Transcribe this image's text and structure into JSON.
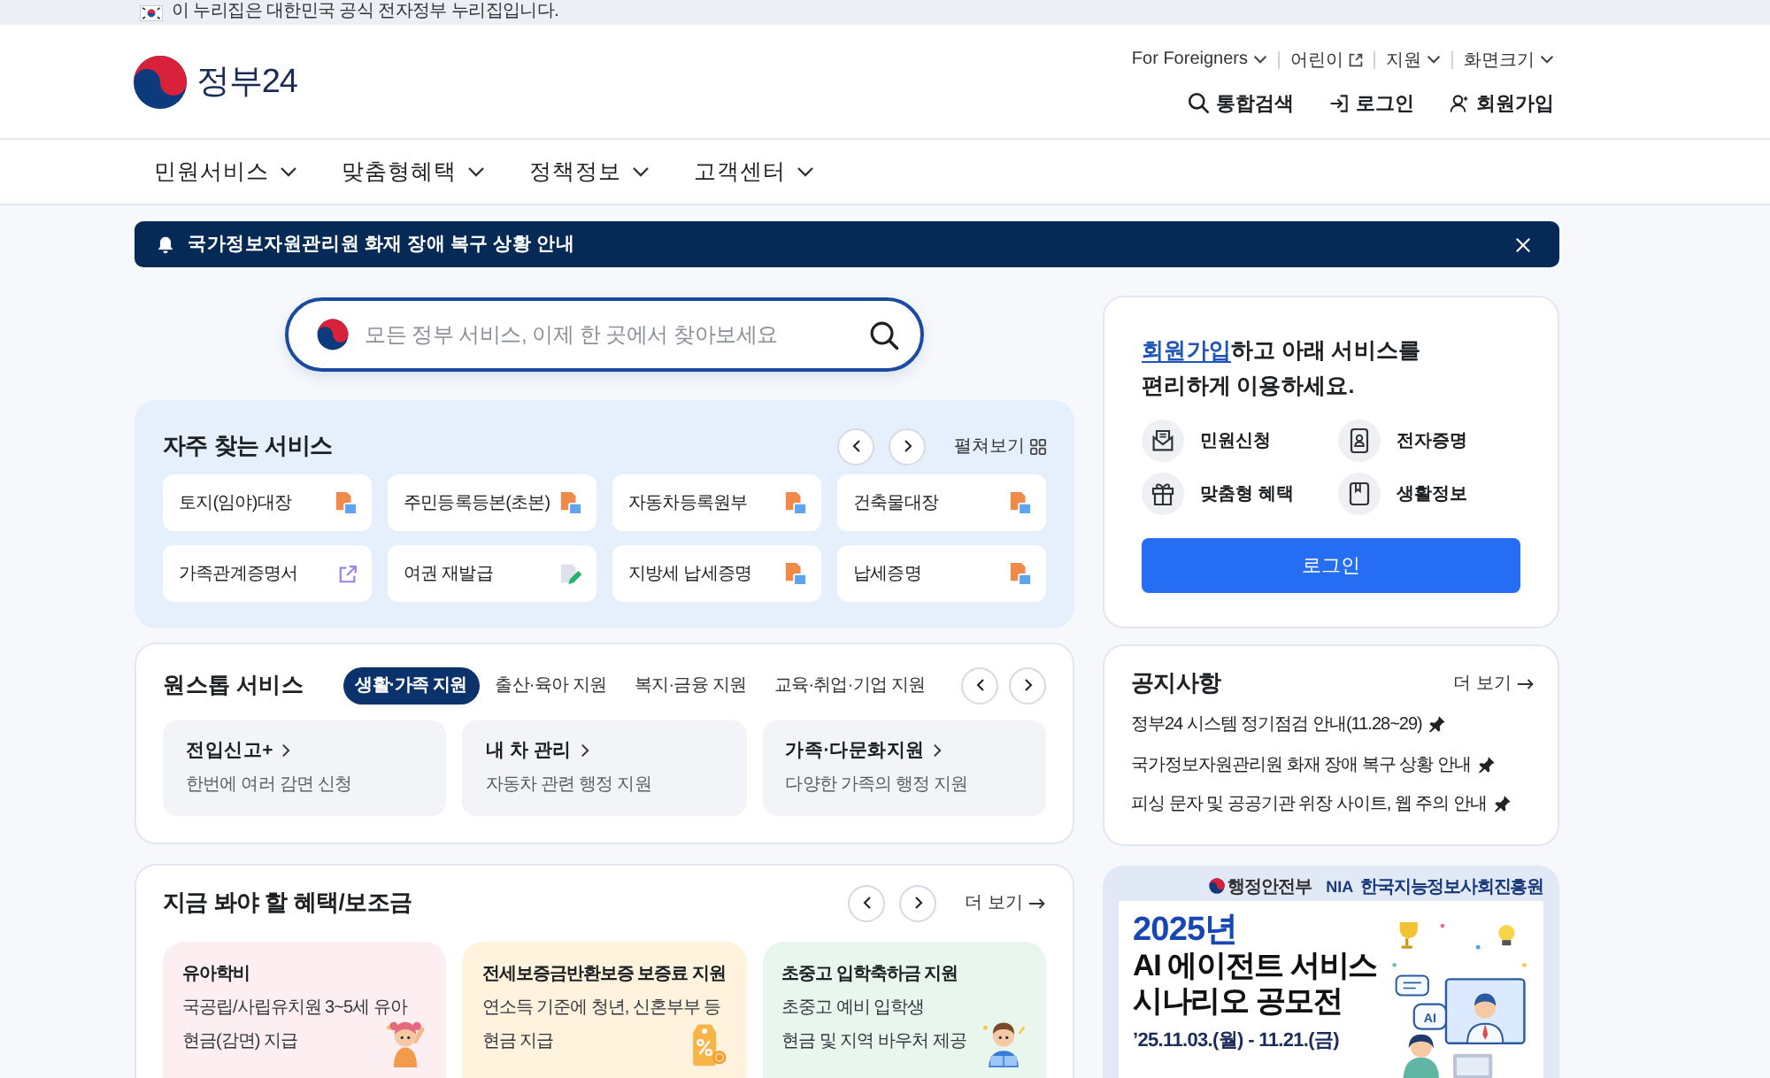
{
  "gov_notice": {
    "text": "이 누리집은 대한민국 공식 전자정부 누리집입니다."
  },
  "header": {
    "logo": "정부24",
    "utility_links": [
      {
        "label": "For Foreigners",
        "kind": "dropdown"
      },
      {
        "label": "어린이",
        "kind": "external"
      },
      {
        "label": "지원",
        "kind": "dropdown"
      },
      {
        "label": "화면크기",
        "kind": "dropdown"
      }
    ],
    "actions": [
      {
        "label": "통합검색",
        "kind": "search"
      },
      {
        "label": "로그인",
        "kind": "login"
      },
      {
        "label": "회원가입",
        "kind": "signup"
      }
    ]
  },
  "nav": {
    "items": [
      "민원서비스",
      "맞춤형혜택",
      "정책정보",
      "고객센터"
    ]
  },
  "alert": {
    "text": "국가정보자원관리원 화재 장애 복구 상황 안내"
  },
  "search": {
    "placeholder": "모든 정부 서비스, 이제 한 곳에서 찾아보세요"
  },
  "frequent_services": {
    "title": "자주 찾는 서비스",
    "expand": "펼쳐보기",
    "items": [
      {
        "label": "토지(임야)대장",
        "kind": "document"
      },
      {
        "label": "주민등록등본(초본)",
        "kind": "document"
      },
      {
        "label": "자동차등록원부",
        "kind": "document"
      },
      {
        "label": "건축물대장",
        "kind": "document"
      },
      {
        "label": "가족관계증명서",
        "kind": "external"
      },
      {
        "label": "여권 재발급",
        "kind": "edit"
      },
      {
        "label": "지방세 납세증명",
        "kind": "document"
      },
      {
        "label": "납세증명",
        "kind": "document"
      }
    ]
  },
  "one_stop": {
    "title": "원스톱 서비스",
    "tabs": [
      {
        "label": "생활·가족 지원",
        "selected": true
      },
      {
        "label": "출산·육아 지원",
        "selected": false
      },
      {
        "label": "복지·금융 지원",
        "selected": false
      },
      {
        "label": "교육·취업·기업 지원",
        "selected": false
      }
    ],
    "cards": [
      {
        "title": "전입신고+",
        "description": "한번에 여러 감면 신청"
      },
      {
        "title": "내 차 관리",
        "description": "자동차 관련 행정 지원"
      },
      {
        "title": "가족·다문화지원",
        "description": "다양한 가족의 행정 지원"
      }
    ]
  },
  "benefits": {
    "title": "지금 봐야 할 혜택/보조금",
    "more": "더 보기",
    "cards": [
      {
        "title": "유아학비",
        "lines": [
          "국공립/사립유치원 3~5세 유아",
          "현금(감면) 지급"
        ],
        "kind": "child"
      },
      {
        "title": "전세보증금반환보증 보증료 지원",
        "lines": [
          "연소득 기준에 청년, 신혼부부 등",
          "현금 지급"
        ],
        "kind": "discount"
      },
      {
        "title": "초중고 입학축하금 지원",
        "lines": [
          "초중고 예비 입학생",
          "현금 및 지역 바우처 제공"
        ],
        "kind": "student"
      }
    ]
  },
  "login_card": {
    "link": "회원가입",
    "lines": [
      "하고 아래 서비스를",
      "편리하게 이용하세요."
    ],
    "services": [
      {
        "label": "민원신청",
        "kind": "mail"
      },
      {
        "label": "전자증명",
        "kind": "certificate"
      },
      {
        "label": "맞춤형 혜택",
        "kind": "gift"
      },
      {
        "label": "생활정보",
        "kind": "book"
      }
    ],
    "button": "로그인"
  },
  "notices": {
    "title": "공지사항",
    "more": "더 보기",
    "items": [
      {
        "text": "정부24 시스템 정기점검 안내(11.28~29)",
        "pinned": true
      },
      {
        "text": "국가정보자원관리원 화재 장애 복구 상황 안내",
        "pinned": true
      },
      {
        "text": "피싱 문자 및 공공기관 위장 사이트, 웹 주의 안내",
        "pinned": true
      }
    ]
  },
  "banner": {
    "ministry": "행정안전부",
    "agency_mark": "NIA",
    "agency": "한국지능정보사회진흥원",
    "year": "2025년",
    "title_lines": [
      "AI 에이전트 서비스",
      "시나리오 공모전"
    ],
    "period": "’25.11.03.(월) - 11.21.(금)",
    "illustration_label": "AI"
  }
}
